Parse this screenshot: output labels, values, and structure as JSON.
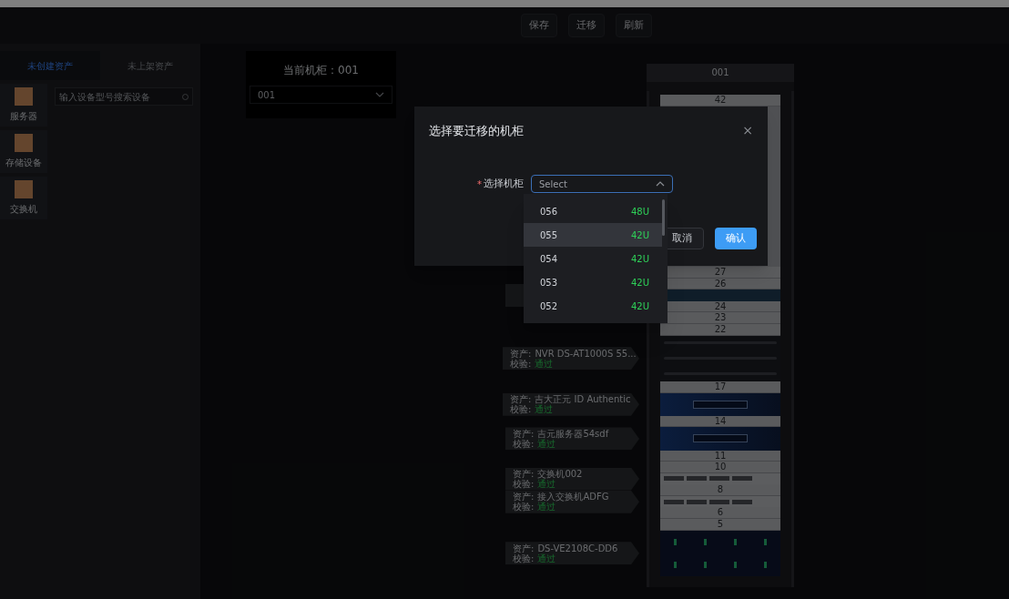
{
  "toolbar": {
    "buttons": [
      "保存",
      "迁移",
      "刷新"
    ]
  },
  "left_panel": {
    "tabs": [
      {
        "label": "未创建资产",
        "selected": true
      },
      {
        "label": "未上架资产",
        "selected": false
      }
    ],
    "categories": [
      {
        "label": "服务器"
      },
      {
        "label": "存储设备"
      },
      {
        "label": "交换机"
      }
    ],
    "search": {
      "placeholder": "输入设备型号搜索设备"
    }
  },
  "cabinet_card": {
    "title": "当前机柜：001",
    "select_value": "001"
  },
  "rack": {
    "title": "001",
    "top_units": [
      {
        "number": "42"
      }
    ],
    "units": [
      {
        "kind": "empty",
        "number": "27"
      },
      {
        "kind": "empty",
        "number": "26"
      },
      {
        "kind": "bar",
        "tagged": true
      },
      {
        "kind": "empty",
        "number": "24"
      },
      {
        "kind": "empty",
        "number": "23"
      },
      {
        "kind": "empty",
        "number": "22"
      },
      {
        "kind": "nvr",
        "label": {
          "asset_caption": "资产:",
          "asset": "NVR DS-AT1000S 55...",
          "check_caption": "校验:",
          "check": "通过"
        }
      },
      {
        "kind": "empty",
        "number": "17"
      },
      {
        "kind": "blue-server",
        "label": {
          "asset_caption": "资产:",
          "asset": "吉大正元 ID Authentic",
          "check_caption": "校验:",
          "check": "通过"
        }
      },
      {
        "kind": "empty",
        "number": "14"
      },
      {
        "kind": "blue-server",
        "label": {
          "asset_caption": "资产:",
          "asset": "吉元服务器54sdf",
          "check_caption": "校验:",
          "check": "通过"
        }
      },
      {
        "kind": "empty",
        "number": "11"
      },
      {
        "kind": "empty",
        "number": "10"
      },
      {
        "kind": "switch",
        "label": {
          "asset_caption": "资产:",
          "asset": "交换机002",
          "check_caption": "校验:",
          "check": "通过"
        }
      },
      {
        "kind": "empty",
        "number": "8"
      },
      {
        "kind": "switch",
        "label": {
          "asset_caption": "资产:",
          "asset": "接入交换机ADFG",
          "check_caption": "校验:",
          "check": "通过"
        }
      },
      {
        "kind": "empty",
        "number": "6"
      },
      {
        "kind": "empty",
        "number": "5"
      },
      {
        "kind": "storage",
        "label": {
          "asset_caption": "资产:",
          "asset": "DS-VE2108C-DD6",
          "check_caption": "校验:",
          "check": "通过"
        }
      }
    ]
  },
  "modal": {
    "title": "选择要迁移的机柜",
    "close_glyph": "×",
    "field_label": "选择机柜",
    "required_mark": "*",
    "placeholder": "Select",
    "buttons": [
      {
        "label": "取消",
        "kind": "secondary"
      },
      {
        "label": "确认",
        "kind": "primary"
      }
    ],
    "options": [
      {
        "name": "056",
        "capacity": "48U",
        "selected": false
      },
      {
        "name": "055",
        "capacity": "42U",
        "selected": true
      },
      {
        "name": "054",
        "capacity": "42U",
        "selected": false
      },
      {
        "name": "053",
        "capacity": "42U",
        "selected": false
      },
      {
        "name": "052",
        "capacity": "42U",
        "selected": false
      }
    ]
  }
}
